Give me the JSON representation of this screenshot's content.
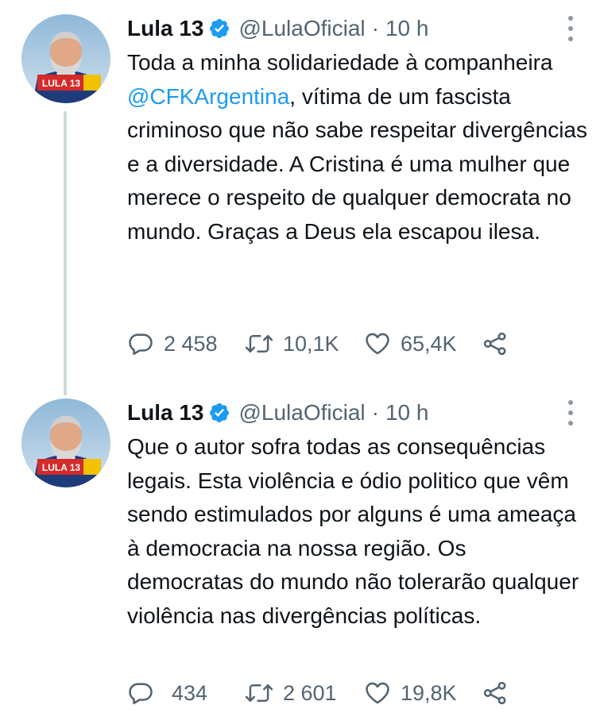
{
  "tweets": [
    {
      "author": {
        "name": "Lula 13",
        "handle": "@LulaOficial",
        "verified": true,
        "avatar_badge": "LULA 13"
      },
      "separator": "·",
      "time": "10 h",
      "text": {
        "before": "Toda a minha solidariedade à companheira ",
        "mention": "@CFKArgentina",
        "after": ", vítima de um fascista criminoso que não sabe respeitar divergências e a diversidade. A Cristina é uma mulher que merece o respeito de qualquer democrata no mundo. Graças a Deus ela escapou ilesa."
      },
      "stats": {
        "replies": "2 458",
        "retweets": "10,1K",
        "likes": "65,4K"
      }
    },
    {
      "author": {
        "name": "Lula 13",
        "handle": "@LulaOficial",
        "verified": true,
        "avatar_badge": "LULA 13"
      },
      "separator": "·",
      "time": "10 h",
      "text": "Que o autor sofra todas as consequências legais. Esta violência e ódio politico que vêm sendo estimulados por alguns é uma ameaça à democracia na nossa região. Os democratas do mundo não tolerarão qualquer violência nas divergências políticas.",
      "stats": {
        "replies": "434",
        "retweets": "2 601",
        "likes": "19,8K"
      }
    }
  ],
  "icons": {
    "verified": "verified-badge-icon",
    "more": "more-vertical-icon",
    "reply": "reply-icon",
    "retweet": "retweet-icon",
    "like": "heart-icon",
    "share": "share-icon"
  },
  "colors": {
    "text": "#0f1419",
    "secondary": "#536471",
    "mention": "#1d9bf0",
    "verified": "#1d9bf0",
    "thread_line": "#cfd9de"
  }
}
